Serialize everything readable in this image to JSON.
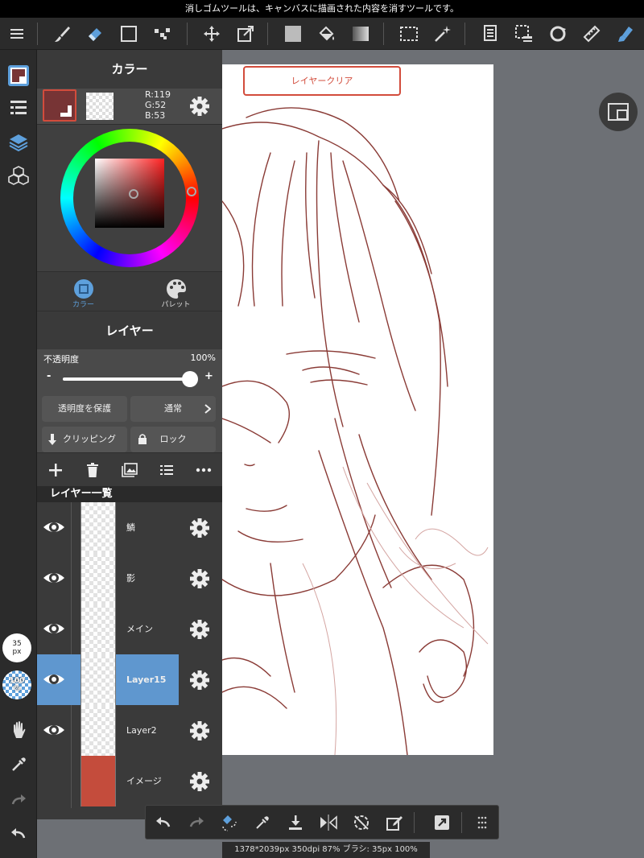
{
  "status_message": "消しゴムツールは、キャンバスに描画された内容を消すツールです。",
  "toolbar": {
    "icons": [
      "menu-icon",
      "brush-icon",
      "eraser-icon",
      "rectangle-icon",
      "dot-icon",
      "move-icon",
      "transform-icon",
      "fill-color-icon",
      "bucket-icon",
      "gradient-icon",
      "selection-icon",
      "magic-wand-icon",
      "layer-stack-icon",
      "select-layer-icon",
      "rotate-icon",
      "ruler-icon",
      "pen-icon"
    ]
  },
  "color_panel": {
    "title": "カラー",
    "main_color": "#773435",
    "rgb": {
      "r": "R:119",
      "g": "G:52",
      "b": "B:53"
    },
    "tabs": [
      {
        "label": "カラー",
        "icon": "color-circle-icon"
      },
      {
        "label": "パレット",
        "icon": "palette-icon"
      }
    ]
  },
  "layer_panel": {
    "title": "レイヤー",
    "opacity_label": "不透明度",
    "opacity_value": "100%",
    "opacity_level": 1.0,
    "minus": "-",
    "plus": "+",
    "protect_alpha": "透明度を保護",
    "blend_mode": "通常",
    "clipping": "クリッピング",
    "lock": "ロック",
    "list_title": "レイヤー一覧",
    "layers": [
      {
        "name": "鱗",
        "selected": false
      },
      {
        "name": "影",
        "selected": false
      },
      {
        "name": "メイン",
        "selected": false
      },
      {
        "name": "Layer15",
        "selected": true
      },
      {
        "name": "Layer2",
        "selected": false
      },
      {
        "name": "イメージ",
        "selected": false
      }
    ]
  },
  "canvas": {
    "clear_button": "レイヤークリア"
  },
  "brush": {
    "size_value": "35",
    "size_unit": "px",
    "opacity_value": "100",
    "opacity_unit": "%"
  },
  "info_bar": "1378*2039px 350dpi 87% ブラシ: 35px 100%",
  "colors": {
    "accent": "#5f97cf",
    "clear_red": "#d24c3c",
    "background_layer": "#c44c3c"
  }
}
